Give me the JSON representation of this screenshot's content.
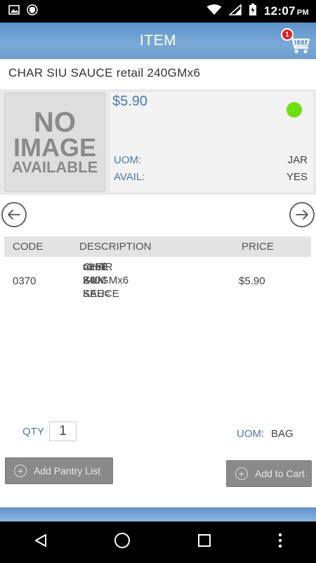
{
  "status_bar": {
    "time": "12:07",
    "ampm": "PM",
    "icons": [
      "gallery-icon",
      "shield-icon",
      "wifi-icon",
      "signal-icon",
      "battery-icon"
    ]
  },
  "app_bar": {
    "title": "ITEM",
    "cart_badge": "1"
  },
  "item": {
    "name": "CHAR SIU SAUCE retail  240GMx6",
    "image_text": [
      "NO",
      "IMAGE",
      "AVAILABLE"
    ],
    "price": "$5.90",
    "availability_color": "#6de010",
    "uom_label": "UOM:",
    "uom_value": "JAR",
    "avail_label": "AVAIL:",
    "avail_value": "YES"
  },
  "table": {
    "headers": [
      "CODE",
      "DESCRIPTION",
      "PRICE"
    ],
    "rows": [
      {
        "code": "0370",
        "description": [
          "CHAR SIU SAUCE",
          "retail  240GMx6",
          "=LEE KUM KEE="
        ],
        "price": "$5.90"
      }
    ]
  },
  "order": {
    "qty_label": "QTY",
    "qty_value": "1",
    "uom_label": "UOM:",
    "uom_value": "BAG"
  },
  "buttons": {
    "add_pantry": "Add Pantry List",
    "add_cart": "Add to Cart"
  },
  "colors": {
    "accent": "#6f9fd0",
    "label_blue": "#4a7ab0",
    "button_gray": "#8a8a8a"
  }
}
